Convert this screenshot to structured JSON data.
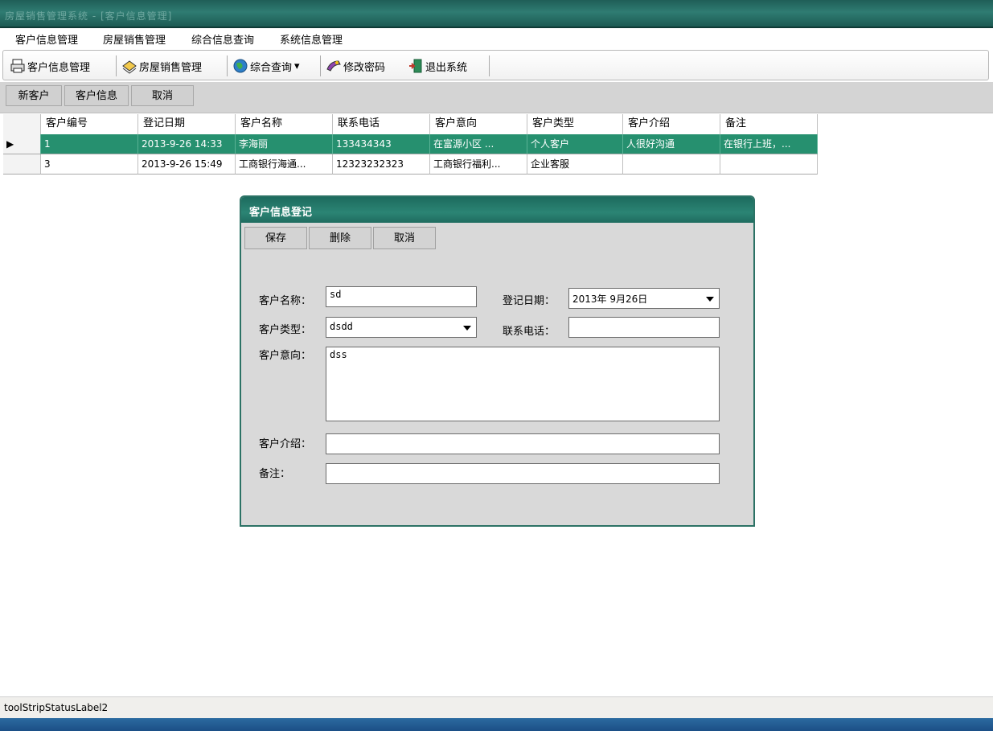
{
  "window": {
    "title": "房屋销售管理系统 - [客户信息管理]"
  },
  "menu": [
    "客户信息管理",
    "房屋销售管理",
    "综合信息查询",
    "系统信息管理"
  ],
  "toolbar": {
    "items": [
      "客户信息管理",
      "房屋销售管理",
      "综合查询",
      "修改密码",
      "退出系统"
    ],
    "dropdown_glyph": "▾"
  },
  "actions": [
    "新客户",
    "客户信息",
    "取消"
  ],
  "grid": {
    "columns": [
      "客户编号",
      "登记日期",
      "客户名称",
      "联系电话",
      "客户意向",
      "客户类型",
      "客户介绍",
      "备注"
    ],
    "rows": [
      [
        "1",
        "2013-9-26 14:33",
        "李海丽",
        "133434343",
        "在富源小区 ...",
        "个人客户",
        "人很好沟通",
        "在银行上班，..."
      ],
      [
        "3",
        "2013-9-26 15:49",
        "工商银行海通...",
        "12323232323",
        "工商银行福利...",
        "企业客服",
        "",
        ""
      ]
    ],
    "selected_marker": "▶"
  },
  "dialog": {
    "title": "客户信息登记",
    "buttons": [
      "保存",
      "删除",
      "取消"
    ],
    "labels": {
      "name": "客户名称：",
      "date": "登记日期：",
      "type": "客户类型：",
      "phone": "联系电话：",
      "intent": "客户意向：",
      "intro": "客户介绍：",
      "remark": "备注："
    },
    "values": {
      "name": "sd",
      "date": "2013年 9月26日",
      "type": "dsdd",
      "phone": "",
      "intent": "dss",
      "intro": "",
      "remark": ""
    }
  },
  "status": {
    "label": "toolStripStatusLabel2"
  },
  "colors": {
    "accent": "#26906f",
    "title": "#2f7c72"
  }
}
